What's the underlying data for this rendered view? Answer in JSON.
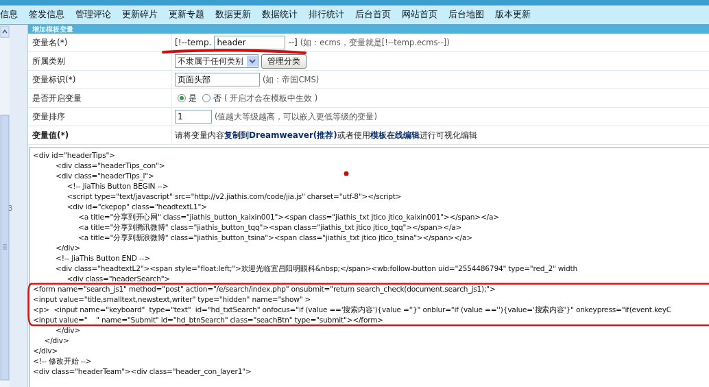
{
  "menu": [
    {
      "label": "信息"
    },
    {
      "label": "签发信息"
    },
    {
      "label": "管理评论"
    },
    {
      "label": "更新碎片"
    },
    {
      "label": "更新专题"
    },
    {
      "label": "数据更新"
    },
    {
      "label": "数据统计"
    },
    {
      "label": "排行统计"
    },
    {
      "label": "后台首页"
    },
    {
      "label": "网站首页"
    },
    {
      "label": "后台地图"
    },
    {
      "label": "版本更新"
    }
  ],
  "sidebar": {
    "marker": "3"
  },
  "panel": {
    "title": "增加模板变量"
  },
  "fields": [
    {
      "kind": "name",
      "label": "变量名(*)",
      "prefix": "[!--temp.",
      "value": "header",
      "suffix": "--]",
      "hint": "(如：ecms，变量就是[!--temp.ecms--])"
    },
    {
      "kind": "select",
      "label": "所属类别",
      "value": "不隶属于任何类别",
      "button": "管理分类"
    },
    {
      "kind": "text",
      "label": "变量标识(*)",
      "value": "页面头部",
      "hint": "(如：帝国CMS)"
    },
    {
      "kind": "radio",
      "label": "是否开启变量",
      "options": [
        {
          "label": "是",
          "selected": true
        },
        {
          "label": "否",
          "selected": false
        }
      ],
      "hint": "( 开启才会在模板中生效 )"
    },
    {
      "kind": "short",
      "label": "变量排序",
      "value": "1",
      "hint": "(值越大等级越高，可以嵌入更低等级的变量)"
    },
    {
      "kind": "note",
      "label": "变量值(*)",
      "text": "请将变量内容**复制到Dreamweaver(推荐)**或者使用**模板在线编辑**进行可视化编辑"
    }
  ],
  "code_lines": [
    "<div id=\"headerTips\">",
    "\t\t<div class=\"headerTips_con\">",
    "\t\t<div class=\"headerTips_l\">",
    "\t\t\t<!-- JiaThis Button BEGIN -->",
    "\t\t\t<script type=\"text/javascript\" src=\"http://v2.jiathis.com/code/jia.js\" charset=\"utf-8\"></script>",
    "\t\t\t<div id=\"ckepop\" class=\"headtextL1\">",
    "\t\t\t\t<a title=\"分享到开心网\" class=\"jiathis_button_kaixin001\"><span class=\"jiathis_txt jtico jtico_kaixin001\"></span></a>",
    "\t\t\t\t<a title=\"分享到腾讯微博\" class=\"jiathis_button_tqq\"><span class=\"jiathis_txt jtico jtico_tqq\"></span></a>",
    "\t\t\t\t<a title=\"分享到新浪微博\" class=\"jiathis_button_tsina\"><span class=\"jiathis_txt jtico jtico_tsina\"></span></a>",
    "\t\t</div>",
    "\t\t<!-- JiaThis Button END -->",
    "\t\t<div class=\"headtextL2\"><span style=\"float:left;\">欢迎光临宜昌阳明眼科&nbsp;</span><wb:follow-button uid=\"2554486794\" type=\"red_2\" width",
    "\t\t\t<div class=\"headerSearch\">",
    "<form name=\"search_js1\" method=\"post\" action=\"/e/search/index.php\" onsubmit=\"return search_check(document.search_js1);\">",
    "<input value=\"title,smalltext,newstext,writer\" type=\"hidden\" name=\"show\" >",
    "<p>  <input name=\"keyboard\"  type=\"text\"  id=\"hd_txtSearch\" onfocus=\"if (value =='搜索内容'){value =''}\" onblur=\"if (value ==''){value='搜索内容'}\" onkeypress=\"if(event.keyC",
    "<input value=\"    \" name=\"Submit\" id=\"hd_btnSearch\" class=\"seachBtn\" type=\"submit\"></form>",
    "\t\t</div>",
    "\t</div>",
    "</div>",
    "<!-- 修改开始 -->",
    "<div class=\"headerTeam\"><div class=\"header_con_layer1\">"
  ]
}
